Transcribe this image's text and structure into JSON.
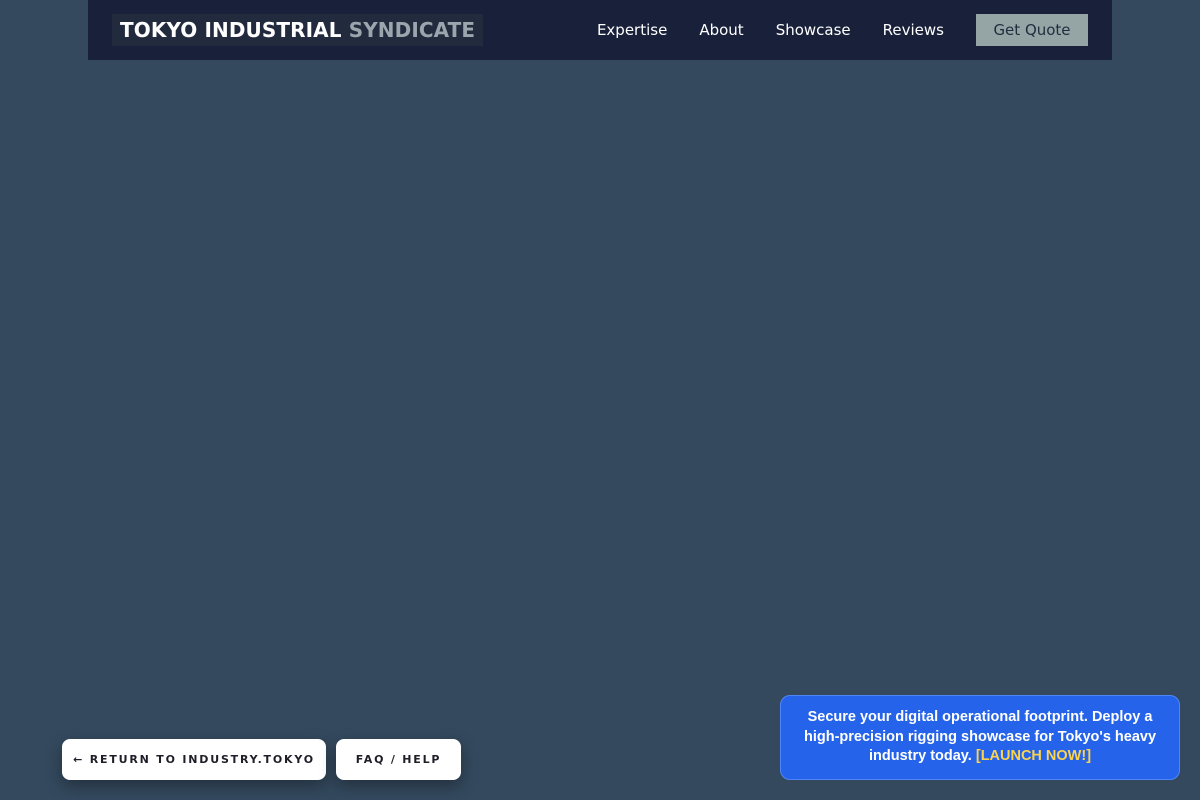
{
  "header": {
    "logo_main": "TOKYO INDUSTRIAL",
    "logo_accent": "SYNDICATE",
    "nav": [
      {
        "label": "Expertise"
      },
      {
        "label": "About"
      },
      {
        "label": "Showcase"
      },
      {
        "label": "Reviews"
      }
    ],
    "cta_label": "Get Quote"
  },
  "footer_buttons": {
    "return_label": "← RETURN TO INDUSTRY.TOKYO",
    "faq_label": "FAQ / HELP"
  },
  "promo": {
    "text": "Secure your digital operational footprint. Deploy a high-precision rigging showcase for Tokyo's heavy industry today.",
    "link_label": "[LAUNCH NOW!]"
  },
  "colors": {
    "page_background": "#34495e",
    "header_background": "#18203a",
    "cta_background": "#95a5a6",
    "promo_background": "#2563eb",
    "promo_link": "#fcd34d"
  }
}
